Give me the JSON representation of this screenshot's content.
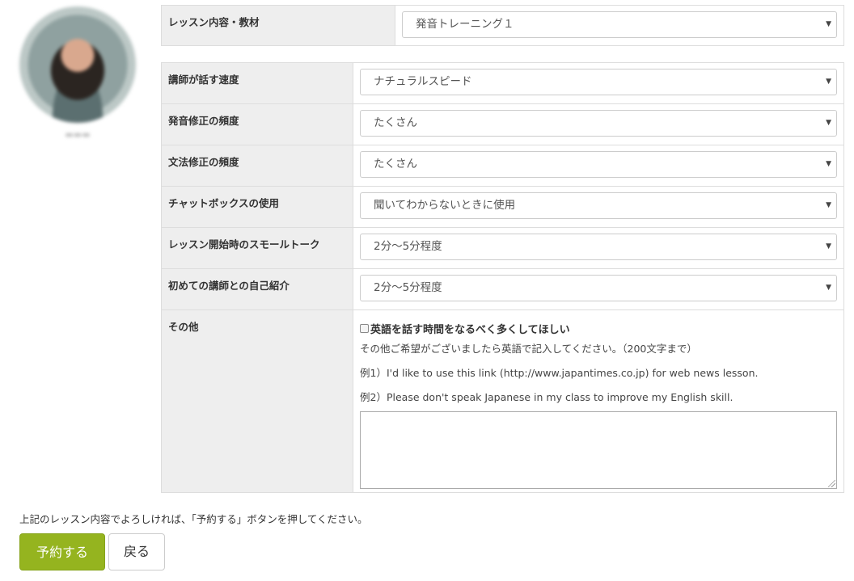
{
  "lesson_material": {
    "label": "レッスン内容・教材",
    "value": "発音トレーニング１"
  },
  "settings": [
    {
      "label": "講師が話す速度",
      "value": "ナチュラルスピード"
    },
    {
      "label": "発音修正の頻度",
      "value": "たくさん"
    },
    {
      "label": "文法修正の頻度",
      "value": "たくさん"
    },
    {
      "label": "チャットボックスの使用",
      "value": "聞いてわからないときに使用"
    },
    {
      "label": "レッスン開始時のスモールトーク",
      "value": "2分〜5分程度"
    },
    {
      "label": "初めての講師との自己紹介",
      "value": "2分〜5分程度"
    }
  ],
  "other": {
    "label": "その他",
    "checkbox_label": "英語を話す時間をなるべく多くしてほしい",
    "checkbox_checked": false,
    "note": "その他ご希望がございましたら英語で記入してください。（200文字まで）",
    "example1": "例1）I'd like to use this link (http://www.japantimes.co.jp) for web news lesson.",
    "example2": "例2）Please don't speak Japanese in my class to improve my English skill.",
    "textarea_value": ""
  },
  "footer": {
    "confirm_text": "上記のレッスン内容でよろしければ、「予約する」ボタンを押してください。",
    "reserve_button": "予約する",
    "back_button": "戻る"
  },
  "icons": {
    "select_caret": "▼"
  },
  "colors": {
    "reserve_button_bg": "#95b41f",
    "label_cell_bg": "#eeeeee"
  }
}
